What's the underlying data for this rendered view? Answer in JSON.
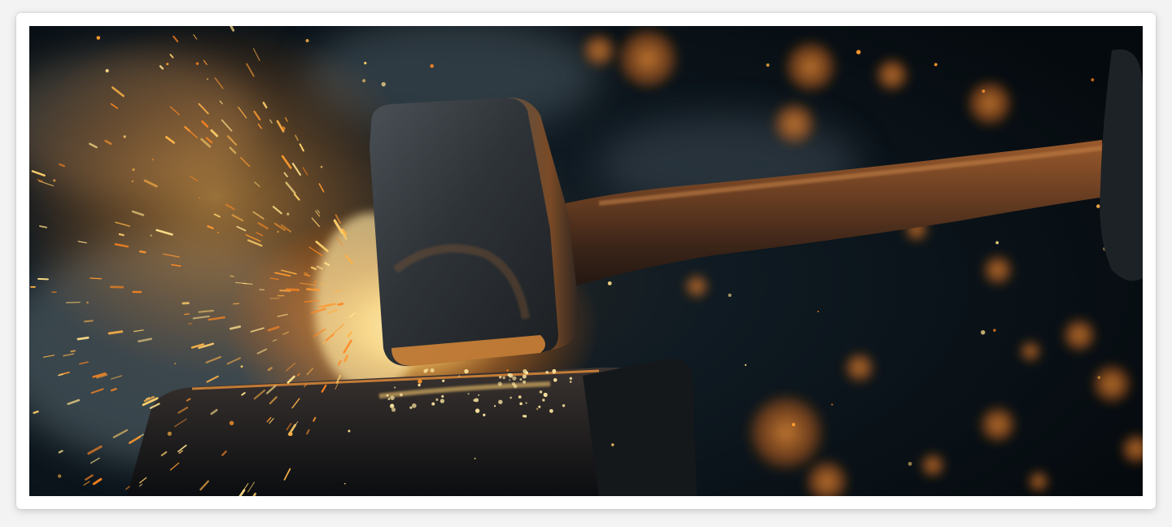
{
  "image": {
    "subject": "sledgehammer-striking-anvil-with-sparks",
    "colors": {
      "background": "#070d12",
      "spark": "#ffb347",
      "glow": "#ff9a2e",
      "hot_core": "#fff3c4",
      "iron": "#3a3f44",
      "rust": "#b5652b",
      "frame": "#ffffff"
    }
  }
}
